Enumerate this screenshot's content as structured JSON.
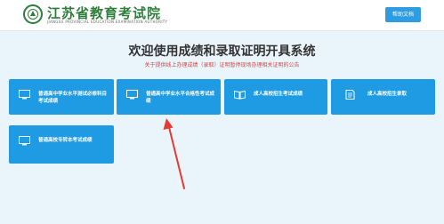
{
  "header": {
    "title": "江苏省教育考试院",
    "subtitle": "JIANGSU PROVINCIAL EDUCATION EXAMINATION AUTHORITY",
    "help_label": "帮助文档"
  },
  "main": {
    "title": "欢迎使用成绩和录取证明开具系统",
    "notice": "关于提供线上办理成绩（录取）证明暂停现场办理相关证明的公告"
  },
  "cards": [
    {
      "label": "普通高中学业水平测试必修科目考试成绩",
      "icon": "monitor-icon"
    },
    {
      "label": "普通高中学业水平合格性考试成绩",
      "icon": "monitor-icon"
    },
    {
      "label": "成人高校招生考试成绩",
      "icon": "book-icon"
    },
    {
      "label": "成人高校招生录取",
      "icon": "document-icon"
    },
    {
      "label": "普通高校专转本考试成绩",
      "icon": "monitor-icon"
    }
  ],
  "colors": {
    "accent": "#1e9be3",
    "header_green": "#2e7d3a",
    "notice_red": "#e2413a",
    "arrow_red": "#e53935",
    "background": "#eaf4fb"
  }
}
